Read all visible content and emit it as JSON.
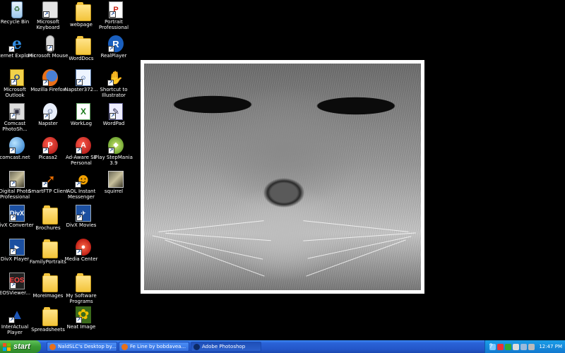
{
  "desktop_icons": [
    {
      "label": "Recycle Bin",
      "icon": "recycle-bin-icon",
      "cls": "ic-recycle",
      "glyph": "♻",
      "col": 0,
      "row": 0
    },
    {
      "label": "Internet Explorer",
      "icon": "internet-explorer-icon",
      "cls": "ic-ie",
      "glyph": "e",
      "col": 0,
      "row": 1
    },
    {
      "label": "Microsoft Outlook",
      "icon": "outlook-icon",
      "cls": "ic-outlook",
      "glyph": "O",
      "col": 0,
      "row": 2
    },
    {
      "label": "Comcast PhotoSh...",
      "icon": "comcast-photoshow-icon",
      "cls": "ic-comcast",
      "glyph": "▣",
      "col": 0,
      "row": 3
    },
    {
      "label": "comcast.net",
      "icon": "comcast-net-icon",
      "cls": "ic-globe",
      "glyph": "",
      "col": 0,
      "row": 4
    },
    {
      "label": "Digital Photo Professional",
      "icon": "digital-photo-professional-icon",
      "cls": "ic-thumb",
      "glyph": "",
      "col": 0,
      "row": 5
    },
    {
      "label": "DivX Converter",
      "icon": "divx-converter-icon",
      "cls": "ic-dv",
      "glyph": "DivX",
      "col": 0,
      "row": 6
    },
    {
      "label": "DivX Player",
      "icon": "divx-player-icon",
      "cls": "ic-dv",
      "glyph": "▶",
      "col": 0,
      "row": 7
    },
    {
      "label": "EOSViewer...",
      "icon": "eos-viewer-icon",
      "cls": "ic-eos",
      "glyph": "EOS",
      "col": 0,
      "row": 8
    },
    {
      "label": "InterActual Player",
      "icon": "interactual-player-icon",
      "cls": "ic-interactual",
      "glyph": "▲",
      "col": 0,
      "row": 9
    },
    {
      "label": "Microsoft Keyboard",
      "icon": "keyboard-icon",
      "cls": "ic-kbd",
      "glyph": "",
      "col": 1,
      "row": 0
    },
    {
      "label": "Microsoft Mouse",
      "icon": "mouse-icon",
      "cls": "ic-mouse",
      "glyph": "",
      "col": 1,
      "row": 1
    },
    {
      "label": "Mozilla Firefox",
      "icon": "firefox-icon",
      "cls": "ic-ff",
      "glyph": "",
      "col": 1,
      "row": 2
    },
    {
      "label": "Napster",
      "icon": "napster-icon",
      "cls": "ic-napster",
      "glyph": "☺",
      "col": 1,
      "row": 3
    },
    {
      "label": "Picasa2",
      "icon": "picasa-icon",
      "cls": "ic-red",
      "glyph": "P",
      "col": 1,
      "row": 4
    },
    {
      "label": "SmartFTP Client",
      "icon": "smartftp-icon",
      "cls": "ic-sftp",
      "glyph": "➚",
      "col": 1,
      "row": 5
    },
    {
      "label": "Brochures",
      "icon": "folder-icon",
      "cls": "ic-folder",
      "glyph": "",
      "col": 1,
      "row": 6
    },
    {
      "label": "FamilyPortraits",
      "icon": "folder-icon",
      "cls": "ic-folder",
      "glyph": "",
      "col": 1,
      "row": 7
    },
    {
      "label": "MoreImages",
      "icon": "folder-icon",
      "cls": "ic-folder",
      "glyph": "",
      "col": 1,
      "row": 8
    },
    {
      "label": "Spreadsheets",
      "icon": "folder-icon",
      "cls": "ic-folder",
      "glyph": "",
      "col": 1,
      "row": 9
    },
    {
      "label": "webpage",
      "icon": "folder-icon",
      "cls": "ic-folder",
      "glyph": "",
      "col": 2,
      "row": 0
    },
    {
      "label": "WordDocs",
      "icon": "folder-icon",
      "cls": "ic-folder",
      "glyph": "",
      "col": 2,
      "row": 1
    },
    {
      "label": "Napster372...",
      "icon": "napster-installer-icon",
      "cls": "ic-tv",
      "glyph": "☺",
      "col": 2,
      "row": 2
    },
    {
      "label": "WorkLog",
      "icon": "excel-icon",
      "cls": "ic-xl",
      "glyph": "X",
      "col": 2,
      "row": 3
    },
    {
      "label": "Ad-Aware SE Personal",
      "icon": "ad-aware-icon",
      "cls": "ic-red",
      "glyph": "A",
      "col": 2,
      "row": 4
    },
    {
      "label": "AOL Instant Messenger",
      "icon": "aim-icon",
      "cls": "ic-aol",
      "glyph": "☻",
      "col": 2,
      "row": 5
    },
    {
      "label": "DivX Movies",
      "icon": "divx-movies-icon",
      "cls": "ic-dv",
      "glyph": "✈",
      "col": 2,
      "row": 6
    },
    {
      "label": "Media Center",
      "icon": "media-center-icon",
      "cls": "ic-mc",
      "glyph": "●",
      "col": 2,
      "row": 7
    },
    {
      "label": "My Software Programs",
      "icon": "folder-icon",
      "cls": "ic-folder",
      "glyph": "",
      "col": 2,
      "row": 8
    },
    {
      "label": "Neat Image",
      "icon": "neat-image-icon",
      "cls": "ic-flower",
      "glyph": "✿",
      "col": 2,
      "row": 9
    },
    {
      "label": "Portrait Professional",
      "icon": "portrait-professional-icon",
      "cls": "ic-pp",
      "glyph": "P",
      "col": 3,
      "row": 0
    },
    {
      "label": "RealPlayer",
      "icon": "realplayer-icon",
      "cls": "ic-rp",
      "glyph": "R",
      "col": 3,
      "row": 1
    },
    {
      "label": "Shortcut to Illustrator",
      "icon": "illustrator-icon",
      "cls": "ic-hand",
      "glyph": "✋",
      "col": 3,
      "row": 2
    },
    {
      "label": "WordPad",
      "icon": "wordpad-icon",
      "cls": "ic-wp",
      "glyph": "✎",
      "col": 3,
      "row": 3
    },
    {
      "label": "Play StepMania 3.9",
      "icon": "stepmania-icon",
      "cls": "ic-step",
      "glyph": "◆",
      "col": 3,
      "row": 4
    },
    {
      "label": "squirrel",
      "icon": "image-thumbnail-icon",
      "cls": "ic-thumb",
      "glyph": "",
      "col": 3,
      "row": 5
    }
  ],
  "taskbar": {
    "start_label": "start",
    "items": [
      {
        "label": "NaldSLC's Desktop by...",
        "icon": "firefox-icon",
        "color": "#e8701a",
        "active": false
      },
      {
        "label": "Fe Line by bobdavea...",
        "icon": "firefox-icon",
        "color": "#e8701a",
        "active": false
      },
      {
        "label": "Adobe Photoshop",
        "icon": "photoshop-icon",
        "color": "#0c2a66",
        "active": true
      }
    ],
    "help_glyph": "?",
    "clock": "12:47 PM"
  },
  "colors": {
    "desktop_bg": "#000000",
    "taskbar_blue": "#2457c9",
    "start_green": "#3a9b34",
    "tray_blue": "#1279cf"
  }
}
